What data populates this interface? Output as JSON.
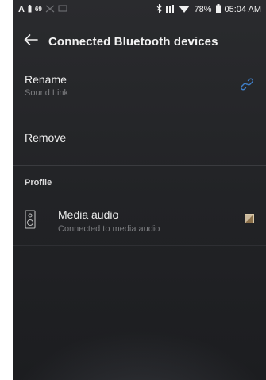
{
  "status_bar": {
    "left_letter": "A",
    "left_badge": "69",
    "battery_percent": "78%",
    "time": "05:04 AM",
    "icons": [
      "a-icon",
      "battery-small-icon",
      "signal-off-icon",
      "cast-icon",
      "bluetooth-icon",
      "signal-bars-icon",
      "wifi-icon",
      "battery-icon"
    ]
  },
  "header": {
    "title": "Connected Bluetooth devices",
    "back_icon": "arrow-left-icon"
  },
  "rename": {
    "label": "Rename",
    "value": "Sound Link",
    "icon": "link-icon",
    "icon_color": "#3f7fc9"
  },
  "remove": {
    "label": "Remove"
  },
  "profile_section": {
    "label": "Profile"
  },
  "media_audio": {
    "title": "Media audio",
    "subtitle": "Connected to media audio",
    "icon": "speaker-icon",
    "checked": true,
    "check_color": "#c9b79b"
  }
}
